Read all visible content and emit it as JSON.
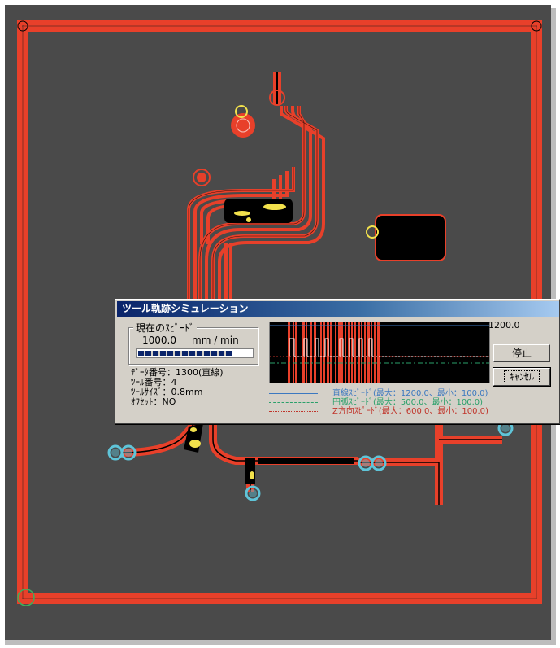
{
  "colors": {
    "background": "#4a4a4a",
    "toolpath": "#e8402a",
    "marker": "#f2e14c",
    "tool_ring": "#5fc4d8",
    "graph_bg": "#000000",
    "linear_speed": "#3b78c0",
    "arc_speed": "#2aa06a",
    "z_speed": "#c0342a"
  },
  "dialog": {
    "title": "ツール軌跡シミュレーション",
    "current_speed_group": "現在のｽﾋﾟｰﾄﾞ",
    "current_speed_value": "1000.0",
    "current_speed_unit": "mm / min",
    "speed_progress": 0.83,
    "data_number": "ﾃﾞｰﾀ番号：1300(直線)",
    "tool_number": "ﾂｰﾙ番号：4",
    "tool_size": "ﾂｰﾙｻｲｽﾞ：0.8mm",
    "offset": "ｵﾌｾｯﾄ：NO",
    "graph_max": "1200.0",
    "legend_linear": "直線ｽﾋﾟｰﾄﾞ(最大：1200.0、最小：100.0)",
    "legend_arc": "円弧ｽﾋﾟｰﾄﾞ(最大：500.0、最小：100.0)",
    "legend_z": "Z方向ｽﾋﾟｰﾄﾞ(最大：600.0、最小：100.0)",
    "stop_button": "停止",
    "cancel_button": "ｷｬﾝｾﾙ"
  }
}
